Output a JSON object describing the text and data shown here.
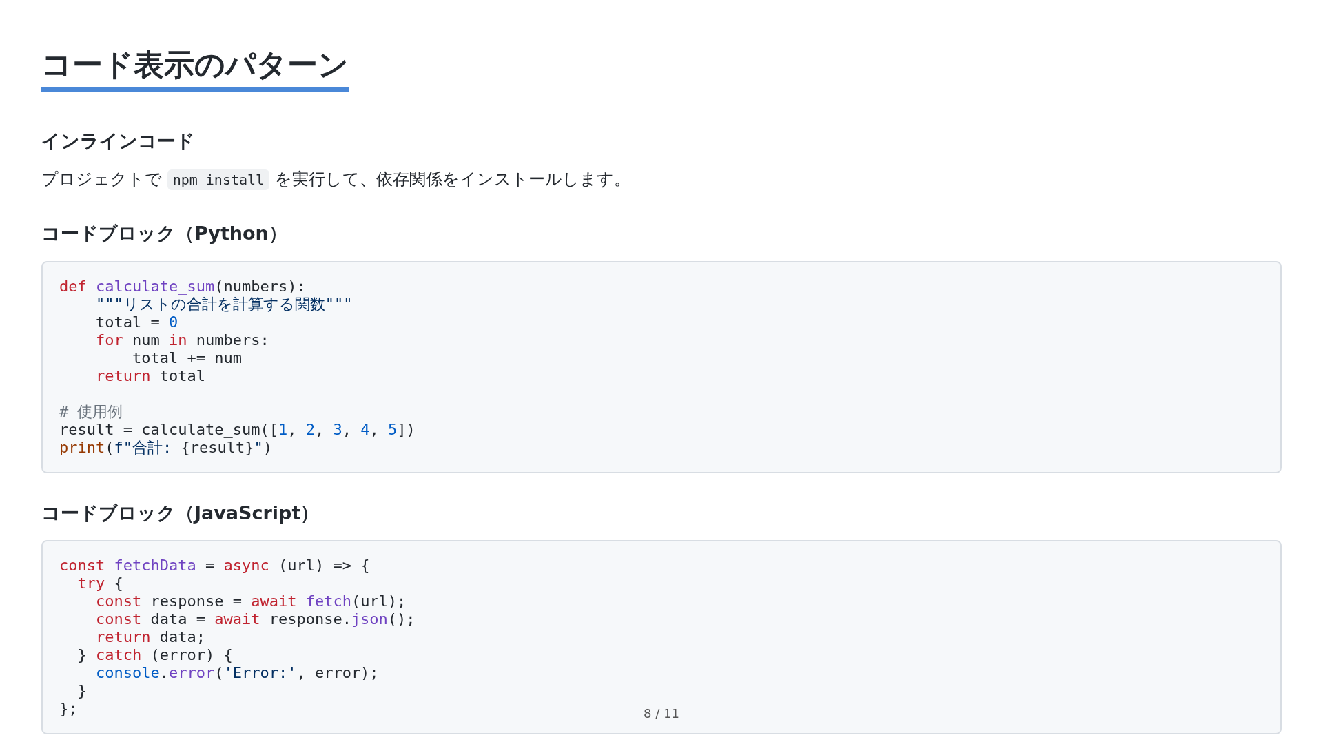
{
  "title": "コード表示のパターン",
  "sections": [
    {
      "kind": "paragraph",
      "heading": "インラインコード",
      "segments": [
        {
          "kind": "text",
          "text": "プロジェクトで "
        },
        {
          "kind": "code",
          "text": "npm install"
        },
        {
          "kind": "text",
          "text": " を実行して、依存関係をインストールします。"
        }
      ]
    },
    {
      "kind": "code",
      "heading": "コードブロック（Python）",
      "lines": [
        {
          "kind": "code",
          "tokens": [
            {
              "kind": "keyword",
              "text": "def "
            },
            {
              "kind": "function",
              "text": "calculate_sum"
            },
            {
              "kind": "plain",
              "text": "(numbers):"
            }
          ]
        },
        {
          "kind": "code",
          "tokens": [
            {
              "kind": "string",
              "text": "    \"\"\"リストの合計を計算する関数\"\"\""
            }
          ]
        },
        {
          "kind": "code",
          "tokens": [
            {
              "kind": "plain",
              "text": "    total = "
            },
            {
              "kind": "number",
              "text": "0"
            }
          ]
        },
        {
          "kind": "code",
          "tokens": [
            {
              "kind": "keyword",
              "text": "    for"
            },
            {
              "kind": "plain",
              "text": " num "
            },
            {
              "kind": "keyword",
              "text": "in"
            },
            {
              "kind": "plain",
              "text": " numbers:"
            }
          ]
        },
        {
          "kind": "code",
          "tokens": [
            {
              "kind": "plain",
              "text": "        total += num"
            }
          ]
        },
        {
          "kind": "code",
          "tokens": [
            {
              "kind": "keyword",
              "text": "    return"
            },
            {
              "kind": "plain",
              "text": " total"
            }
          ]
        },
        {
          "kind": "blank"
        },
        {
          "kind": "code",
          "tokens": [
            {
              "kind": "comment",
              "text": "# 使用例"
            }
          ]
        },
        {
          "kind": "code",
          "tokens": [
            {
              "kind": "plain",
              "text": "result = calculate_sum(["
            },
            {
              "kind": "number",
              "text": "1"
            },
            {
              "kind": "plain",
              "text": ", "
            },
            {
              "kind": "number",
              "text": "2"
            },
            {
              "kind": "plain",
              "text": ", "
            },
            {
              "kind": "number",
              "text": "3"
            },
            {
              "kind": "plain",
              "text": ", "
            },
            {
              "kind": "number",
              "text": "4"
            },
            {
              "kind": "plain",
              "text": ", "
            },
            {
              "kind": "number",
              "text": "5"
            },
            {
              "kind": "plain",
              "text": "])"
            }
          ]
        },
        {
          "kind": "code",
          "tokens": [
            {
              "kind": "builtin",
              "text": "print"
            },
            {
              "kind": "plain",
              "text": "("
            },
            {
              "kind": "string",
              "text": "f\"合計: "
            },
            {
              "kind": "plain",
              "text": "{result}"
            },
            {
              "kind": "string",
              "text": "\""
            },
            {
              "kind": "plain",
              "text": ")"
            }
          ]
        }
      ]
    },
    {
      "kind": "code",
      "heading": "コードブロック（JavaScript）",
      "lines": [
        {
          "kind": "code",
          "tokens": [
            {
              "kind": "keyword",
              "text": "const "
            },
            {
              "kind": "function",
              "text": "fetchData"
            },
            {
              "kind": "plain",
              "text": " = "
            },
            {
              "kind": "keyword",
              "text": "async"
            },
            {
              "kind": "plain",
              "text": " (url) => {"
            }
          ]
        },
        {
          "kind": "code",
          "tokens": [
            {
              "kind": "keyword",
              "text": "  try"
            },
            {
              "kind": "plain",
              "text": " {"
            }
          ]
        },
        {
          "kind": "code",
          "tokens": [
            {
              "kind": "keyword",
              "text": "    const"
            },
            {
              "kind": "plain",
              "text": " response = "
            },
            {
              "kind": "keyword",
              "text": "await "
            },
            {
              "kind": "function",
              "text": "fetch"
            },
            {
              "kind": "plain",
              "text": "(url);"
            }
          ]
        },
        {
          "kind": "code",
          "tokens": [
            {
              "kind": "keyword",
              "text": "    const"
            },
            {
              "kind": "plain",
              "text": " data = "
            },
            {
              "kind": "keyword",
              "text": "await"
            },
            {
              "kind": "plain",
              "text": " response."
            },
            {
              "kind": "function",
              "text": "json"
            },
            {
              "kind": "plain",
              "text": "();"
            }
          ]
        },
        {
          "kind": "code",
          "tokens": [
            {
              "kind": "keyword",
              "text": "    return"
            },
            {
              "kind": "plain",
              "text": " data;"
            }
          ]
        },
        {
          "kind": "code",
          "tokens": [
            {
              "kind": "plain",
              "text": "  } "
            },
            {
              "kind": "keyword",
              "text": "catch"
            },
            {
              "kind": "plain",
              "text": " (error) {"
            }
          ]
        },
        {
          "kind": "code",
          "tokens": [
            {
              "kind": "number",
              "text": "    console"
            },
            {
              "kind": "plain",
              "text": "."
            },
            {
              "kind": "function",
              "text": "error"
            },
            {
              "kind": "plain",
              "text": "("
            },
            {
              "kind": "string",
              "text": "'Error:'"
            },
            {
              "kind": "plain",
              "text": ", error);"
            }
          ]
        },
        {
          "kind": "code",
          "tokens": [
            {
              "kind": "plain",
              "text": "  }"
            }
          ]
        },
        {
          "kind": "code",
          "tokens": [
            {
              "kind": "plain",
              "text": "};"
            }
          ]
        }
      ]
    }
  ],
  "page_number": "8 / 11"
}
